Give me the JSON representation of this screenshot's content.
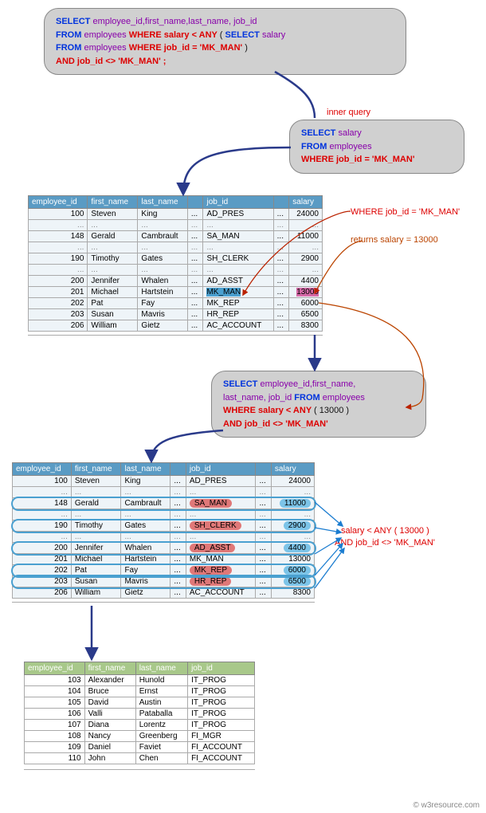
{
  "sqlTop": {
    "l1a": "SELECT ",
    "l1b": "employee_id,first_name,last_name, job_id",
    "l2a": "FROM ",
    "l2b": "employees ",
    "l2c": "WHERE salary < ANY ",
    "l2d": "( ",
    "l2e": "SELECT ",
    "l2f": "salary",
    "l3a": "FROM ",
    "l3b": "employees ",
    "l3c": "WHERE job_id = 'MK_MAN' ",
    "l3d": ")",
    "l4a": "AND job_id <> 'MK_MAN' ;"
  },
  "labelInner": "inner query",
  "sqlInner": {
    "l1a": "SELECT ",
    "l1b": "salary",
    "l2a": "FROM ",
    "l2b": "employees",
    "l3": "WHERE job_id = 'MK_MAN'"
  },
  "annot1": "WHERE job_id = 'MK_MAN'",
  "annot2": "returns salary = 13000",
  "sqlMid": {
    "l1a": "SELECT ",
    "l1b": "employee_id,first_name,",
    "l2a": "last_name, job_id ",
    "l2b": "FROM ",
    "l2c": "employees",
    "l3a": "WHERE salary < ANY ",
    "l3b": "( 13000  )",
    "l4a": "AND job_id <> 'MK_MAN'"
  },
  "annot3a": "salary < ANY ( 13000 )",
  "annot3b": "AND job_id <> 'MK_MAN'",
  "cols12": [
    "employee_id",
    "first_name",
    "last_name",
    "",
    "job_id",
    "",
    "salary"
  ],
  "t1": [
    {
      "id": "100",
      "fn": "Steven",
      "ln": "King",
      "job": "AD_PRES",
      "sal": "24000"
    },
    "dots",
    {
      "id": "148",
      "fn": "Gerald",
      "ln": "Cambrault",
      "job": "SA_MAN",
      "sal": "11000"
    },
    "dots",
    {
      "id": "190",
      "fn": "Timothy",
      "ln": "Gates",
      "job": "SH_CLERK",
      "sal": "2900"
    },
    "dots",
    {
      "id": "200",
      "fn": "Jennifer",
      "ln": "Whalen",
      "job": "AD_ASST",
      "sal": "4400"
    },
    {
      "id": "201",
      "fn": "Michael",
      "ln": "Hartstein",
      "job": "MK_MAN",
      "sal": "13000",
      "hl": true
    },
    {
      "id": "202",
      "fn": "Pat",
      "ln": "Fay",
      "job": "MK_REP",
      "sal": "6000"
    },
    {
      "id": "203",
      "fn": "Susan",
      "ln": "Mavris",
      "job": "HR_REP",
      "sal": "6500"
    },
    {
      "id": "206",
      "fn": "William",
      "ln": "Gietz",
      "job": "AC_ACCOUNT",
      "sal": "8300"
    }
  ],
  "t2": [
    {
      "id": "100",
      "fn": "Steven",
      "ln": "King",
      "job": "AD_PRES",
      "sal": "24000"
    },
    "dots",
    {
      "id": "148",
      "fn": "Gerald",
      "ln": "Cambrault",
      "job": "SA_MAN",
      "sal": "11000",
      "ring": true,
      "pill": true
    },
    "dots",
    {
      "id": "190",
      "fn": "Timothy",
      "ln": "Gates",
      "job": "SH_CLERK",
      "sal": "2900",
      "ring": true,
      "pill": true
    },
    "dots",
    {
      "id": "200",
      "fn": "Jennifer",
      "ln": "Whalen",
      "job": "AD_ASST",
      "sal": "4400",
      "ring": true,
      "pill": true
    },
    {
      "id": "201",
      "fn": "Michael",
      "ln": "Hartstein",
      "job": "MK_MAN",
      "sal": "13000"
    },
    {
      "id": "202",
      "fn": "Pat",
      "ln": "Fay",
      "job": "MK_REP",
      "sal": "6000",
      "ring": true,
      "pill": true
    },
    {
      "id": "203",
      "fn": "Susan",
      "ln": "Mavris",
      "job": "HR_REP",
      "sal": "6500",
      "ring": true,
      "pill": true
    },
    {
      "id": "206",
      "fn": "William",
      "ln": "Gietz",
      "job": "AC_ACCOUNT",
      "sal": "8300"
    }
  ],
  "cols3": [
    "employee_id",
    "first_name",
    "last_name",
    "job_id"
  ],
  "t3": [
    {
      "id": "103",
      "fn": "Alexander",
      "ln": "Hunold",
      "job": "IT_PROG"
    },
    {
      "id": "104",
      "fn": "Bruce",
      "ln": "Ernst",
      "job": "IT_PROG"
    },
    {
      "id": "105",
      "fn": "David",
      "ln": "Austin",
      "job": "IT_PROG"
    },
    {
      "id": "106",
      "fn": "Valli",
      "ln": "Pataballa",
      "job": "IT_PROG"
    },
    {
      "id": "107",
      "fn": "Diana",
      "ln": "Lorentz",
      "job": "IT_PROG"
    },
    {
      "id": "108",
      "fn": "Nancy",
      "ln": "Greenberg",
      "job": "FI_MGR"
    },
    {
      "id": "109",
      "fn": "Daniel",
      "ln": "Faviet",
      "job": "FI_ACCOUNT"
    },
    {
      "id": "110",
      "fn": "John",
      "ln": "Chen",
      "job": "FI_ACCOUNT"
    }
  ],
  "footer": "© w3resource.com"
}
